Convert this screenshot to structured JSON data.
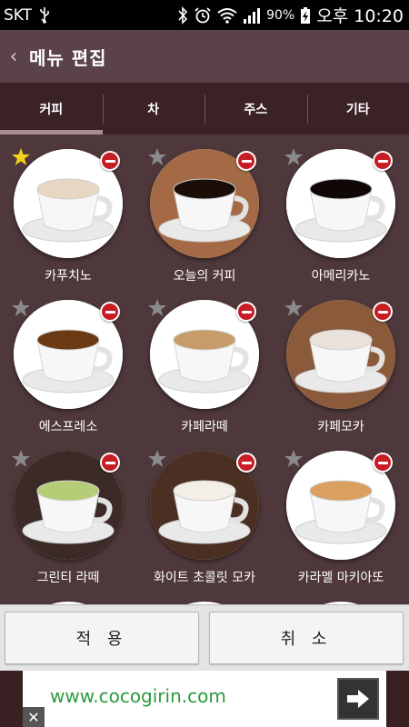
{
  "status": {
    "carrier": "SKT",
    "battery_pct": "90%",
    "time": "오후 10:20"
  },
  "app_bar": {
    "title": "메뉴 편집"
  },
  "tabs": [
    {
      "label": "커피",
      "active": true
    },
    {
      "label": "차",
      "active": false
    },
    {
      "label": "주스",
      "active": false
    },
    {
      "label": "기타",
      "active": false
    }
  ],
  "items": [
    {
      "label": "카푸치노",
      "favorite": true,
      "icon": "cappuccino-icon",
      "drink": "#e7d7c2",
      "bg": "#ffffff"
    },
    {
      "label": "오늘의 커피",
      "favorite": false,
      "icon": "today-coffee-icon",
      "drink": "#1b0d07",
      "bg": "#a36a45"
    },
    {
      "label": "아메리카노",
      "favorite": false,
      "icon": "americano-icon",
      "drink": "#0f0806",
      "bg": "#ffffff"
    },
    {
      "label": "에스프레소",
      "favorite": false,
      "icon": "espresso-icon",
      "drink": "#6b3a13",
      "bg": "#ffffff"
    },
    {
      "label": "카페라떼",
      "favorite": false,
      "icon": "cafe-latte-icon",
      "drink": "#c79c6a",
      "bg": "#ffffff"
    },
    {
      "label": "카페모카",
      "favorite": false,
      "icon": "cafe-mocha-icon",
      "drink": "#e8e2da",
      "bg": "#8a5a3b"
    },
    {
      "label": "그린티 라떼",
      "favorite": false,
      "icon": "green-tea-latte-icon",
      "drink": "#b7cc77",
      "bg": "#3b2a25"
    },
    {
      "label": "화이트 초콜릿 모카",
      "favorite": false,
      "icon": "white-choco-mocha-icon",
      "drink": "#f4efe6",
      "bg": "#4a2f22"
    },
    {
      "label": "카라멜 마키아또",
      "favorite": false,
      "icon": "caramel-macchiato-icon",
      "drink": "#d9a060",
      "bg": "#ffffff"
    }
  ],
  "buttons": {
    "apply": "적 용",
    "cancel": "취 소"
  },
  "ad": {
    "text": "www.cocogirin.com"
  },
  "colors": {
    "favorite_star": "#f2d21c",
    "delete_badge": "#c71d24",
    "ad_text": "#2b9a3f"
  }
}
